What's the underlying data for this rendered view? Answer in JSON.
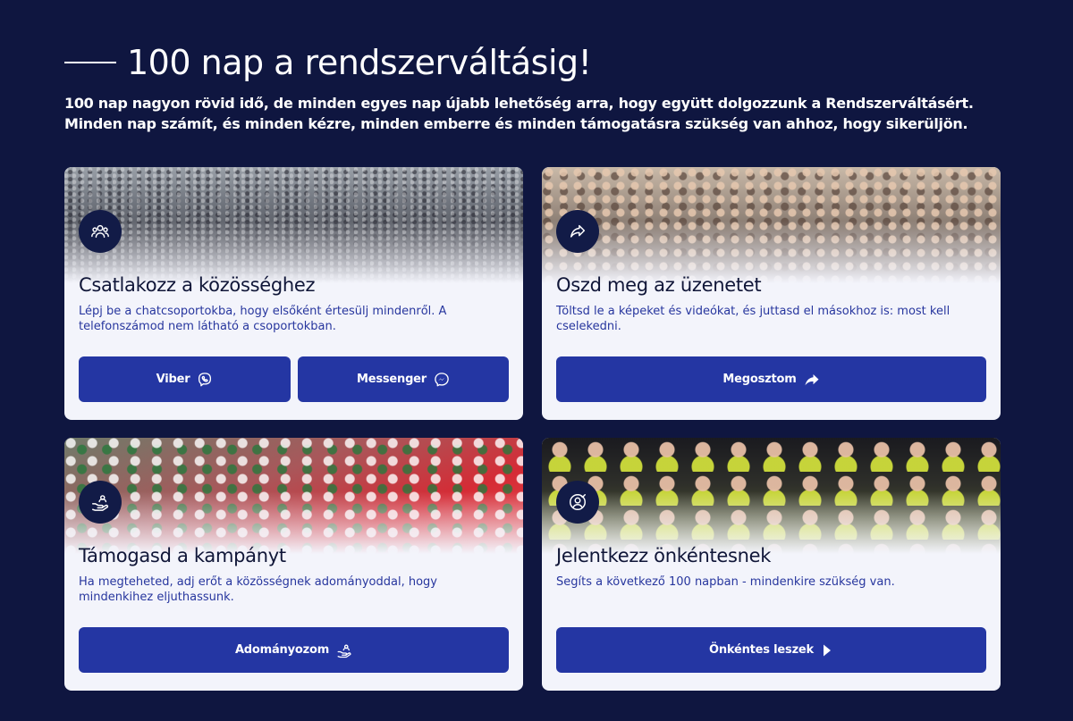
{
  "header": {
    "title": "100 nap a rendszerváltásig!",
    "intro": "100 nap nagyon rövid idő, de minden egyes nap újabb lehetőség arra, hogy együtt dolgozzunk a Rendszerváltásért. Minden nap számít, és minden kézre, minden emberre és minden támogatásra szükség van ahhoz, hogy sikerüljön."
  },
  "cards": [
    {
      "icon": "community-icon",
      "title": "Csatlakozz a közösséghez",
      "description": "Lépj be a chatcsoportokba, hogy elsőként értesülj mindenről. A telefonszámod nem látható a csoportokban.",
      "buttons": [
        {
          "label": "Viber",
          "icon": "viber-icon"
        },
        {
          "label": "Messenger",
          "icon": "messenger-icon"
        }
      ]
    },
    {
      "icon": "share-icon",
      "title": "Oszd meg az üzenetet",
      "description": "Töltsd le a képeket és videókat, és juttasd el másokhoz is: most kell cselekedni.",
      "buttons": [
        {
          "label": "Megosztom",
          "icon": "share-arrow-icon"
        }
      ]
    },
    {
      "icon": "donation-hand-icon",
      "title": "Támogasd a kampányt",
      "description": "Ha megteheted, adj erőt a közösségnek adományoddal, hogy mindenkihez eljuthassunk.",
      "buttons": [
        {
          "label": "Adományozom",
          "icon": "donation-hand-icon"
        }
      ]
    },
    {
      "icon": "volunteer-icon",
      "title": "Jelentkezz önkéntesnek",
      "description": "Segíts a következő 100 napban - mindenkire szükség van.",
      "buttons": [
        {
          "label": "Önkéntes leszek",
          "icon": "play-arrow-icon"
        }
      ]
    }
  ],
  "colors": {
    "background": "#0f1640",
    "card": "#f3f4fb",
    "button": "#2436a3",
    "icon_circle": "#121b47",
    "title_text": "#101638",
    "description_text": "#27369e"
  }
}
